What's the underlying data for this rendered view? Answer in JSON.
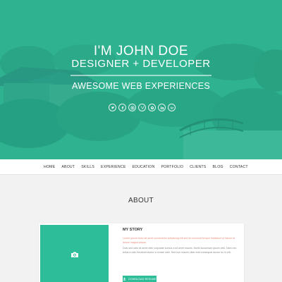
{
  "hero": {
    "name": "I'M JOHN DOE",
    "role": "DESIGNER + DEVELOPER",
    "tagline": "AWESOME WEB EXPERIENCES",
    "socials": [
      "twitter-icon",
      "facebook-icon",
      "instagram-icon",
      "vimeo-icon",
      "github-icon",
      "linkedin-icon",
      "google-plus-icon"
    ]
  },
  "nav": {
    "items": [
      "HOME",
      "ABOUT",
      "SKILLS",
      "EXPERIENCE",
      "EDUCATION",
      "PORTFOLIO",
      "CLIENTS",
      "BLOG",
      "CONTACT"
    ]
  },
  "about": {
    "title": "ABOUT",
    "story_title": "MY STORY",
    "story_highlight": "Lorem ipsum dolor sit amet consectetur adipiscing elit sed do eiusmod tempor incididunt ut labore et dolore magna aliqua.",
    "story_body": "Duis sed odio sit amet nibh vulputate cursus a sit amet mauris. Morbi accumsan ipsum velit. Nam nec tellus a odio tincidunt auctor a ornare odio. Sed non mauris vitae erat consequat auctor eu in elit.",
    "resume_button": "DOWNLOAD RESUME"
  },
  "colors": {
    "accent": "#2ebd99",
    "highlight_text": "#e88f7a"
  }
}
